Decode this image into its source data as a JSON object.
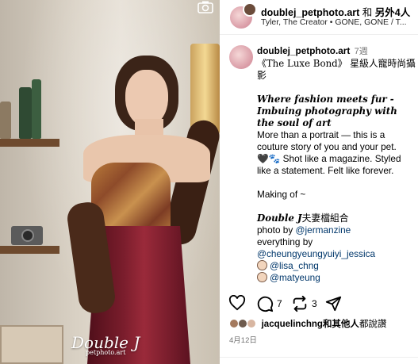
{
  "photo": {
    "watermark_title": "Double J",
    "watermark_sub": "petphoto.art",
    "camera_icon": "camera-icon"
  },
  "header": {
    "username": "doublej_petphoto.art",
    "conj": " 和 ",
    "others": "另外4人",
    "music": "Tyler, The Creator • GONE, GONE / T..."
  },
  "caption": {
    "username": "doublej_petphoto.art",
    "time": "7週",
    "title": "《The Luxe Bond》 星級人寵時尚攝影",
    "tagline": "Where fashion meets fur - Imbuing photography with the soul of art",
    "body1": "More than a portrait — this is a couture story of you and your pet.",
    "body2": " Shot like a magazine. Styled like a statement. Felt like forever.",
    "making": "Making of ~",
    "team": "Double J",
    "team_suffix": "夫妻檔組合",
    "photo_by": "photo by ",
    "photo_mention": "@jermanzine",
    "everything_by": "everything by",
    "everything_mention": "@cheungyeungyuiyi_jessica",
    "mention3": "@lisa_chng",
    "mention4": "@matyeung"
  },
  "actions": {
    "comments_count": "7",
    "reposts_count": "3"
  },
  "likes": {
    "name": "jacquelinchng",
    "rest": "和其他人",
    "suffix": "都說讚"
  },
  "date": "4月12日",
  "colors": {
    "mention": "#00376b",
    "muted": "#737373",
    "skirt": "#7a1d2c"
  }
}
